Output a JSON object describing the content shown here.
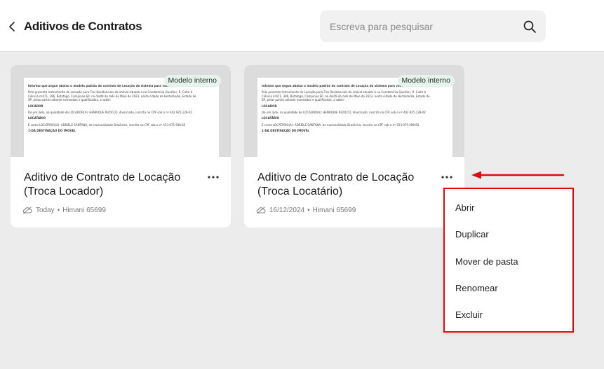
{
  "header": {
    "title": "Aditivos de Contratos",
    "search_placeholder": "Escreva para pesquisar"
  },
  "cards": [
    {
      "badge": "Modelo interno",
      "title": "Aditivo de Contrato de Locação (Troca Locador)",
      "date": "Today",
      "author": "Himani 65699",
      "preview_lines": [
        "Informo que segue abaixo o modelo padrão do contrato de Locação do sistema para você inserir novamente:",
        "Pelo presente Instrumento de Locação para Fins Residenciais do imóvel situado à  no Condomínio Quartier, R. Culto à",
        "Ciência nº471, 396, Botafogo, Campinas-SP, no dia09 do mês de Maio de 2023, nesta cidade de Hortolândia, Estado de",
        "SP, pelas partes adiante nomeadas e qualificadas, a saber:",
        "LOCADOR",
        "De um lado, na qualidade de LOCADOR(A):  HENRIQUE RUOCCO, divorciado, inscrito no CPF sob o nº 442.925.128-02",
        "LOCATÁRIO",
        "E como LOCATÁRIO(A):  ADRIELE SANTANA, de nacionalidade Brasileira, inscrita no CPF sob o nº 523.975.598-65",
        "1-DA DESTINAÇÃO DO IMÓVEL"
      ]
    },
    {
      "badge": "Modelo interno",
      "title": "Aditivo de Contrato de Locação (Troca Locatário)",
      "date": "16/12/2024",
      "author": "Himani 65699",
      "preview_lines": [
        "Informo que segue abaixo o modelo padrão do contrato de Locação do sistema para você inserir novamente:",
        "Pelo presente Instrumento de Locação para Fins Residenciais do imóvel situado à  no Condomínio Quartier, R. Culto à",
        "Ciência nº471, 396, Botafogo, Campinas-SP, no dia09 do mês de Maio de 2023, nesta cidade de Hortolândia, Estado de",
        "SP, pelas partes adiante nomeadas e qualificadas, a saber:",
        "LOCADOR",
        "De um lado, na qualidade de LOCADOR(A):  HENRIQUE RUOCCO, divorciado, inscrito no CPF sob o nº 442.925.128-02",
        "LOCATÁRIO",
        "E como LOCATÁRIO(A):  ADRIELE SANTANA, de nacionalidade Brasileira, inscrita no CPF sob o nº 523.975.598-65",
        "1-DA DESTINAÇÃO DO IMÓVEL"
      ]
    }
  ],
  "meta_separator": "•",
  "context_menu": {
    "items": [
      "Abrir",
      "Duplicar",
      "Mover de pasta",
      "Renomear",
      "Excluir"
    ]
  },
  "colors": {
    "highlight": "#e00d0d",
    "badge_bg": "#e6f3ec",
    "background": "#ececec"
  },
  "icons": {
    "back": "chevron-left-icon",
    "search": "search-icon",
    "more": "more-horizontal-icon",
    "cloud": "cloud-icon"
  }
}
